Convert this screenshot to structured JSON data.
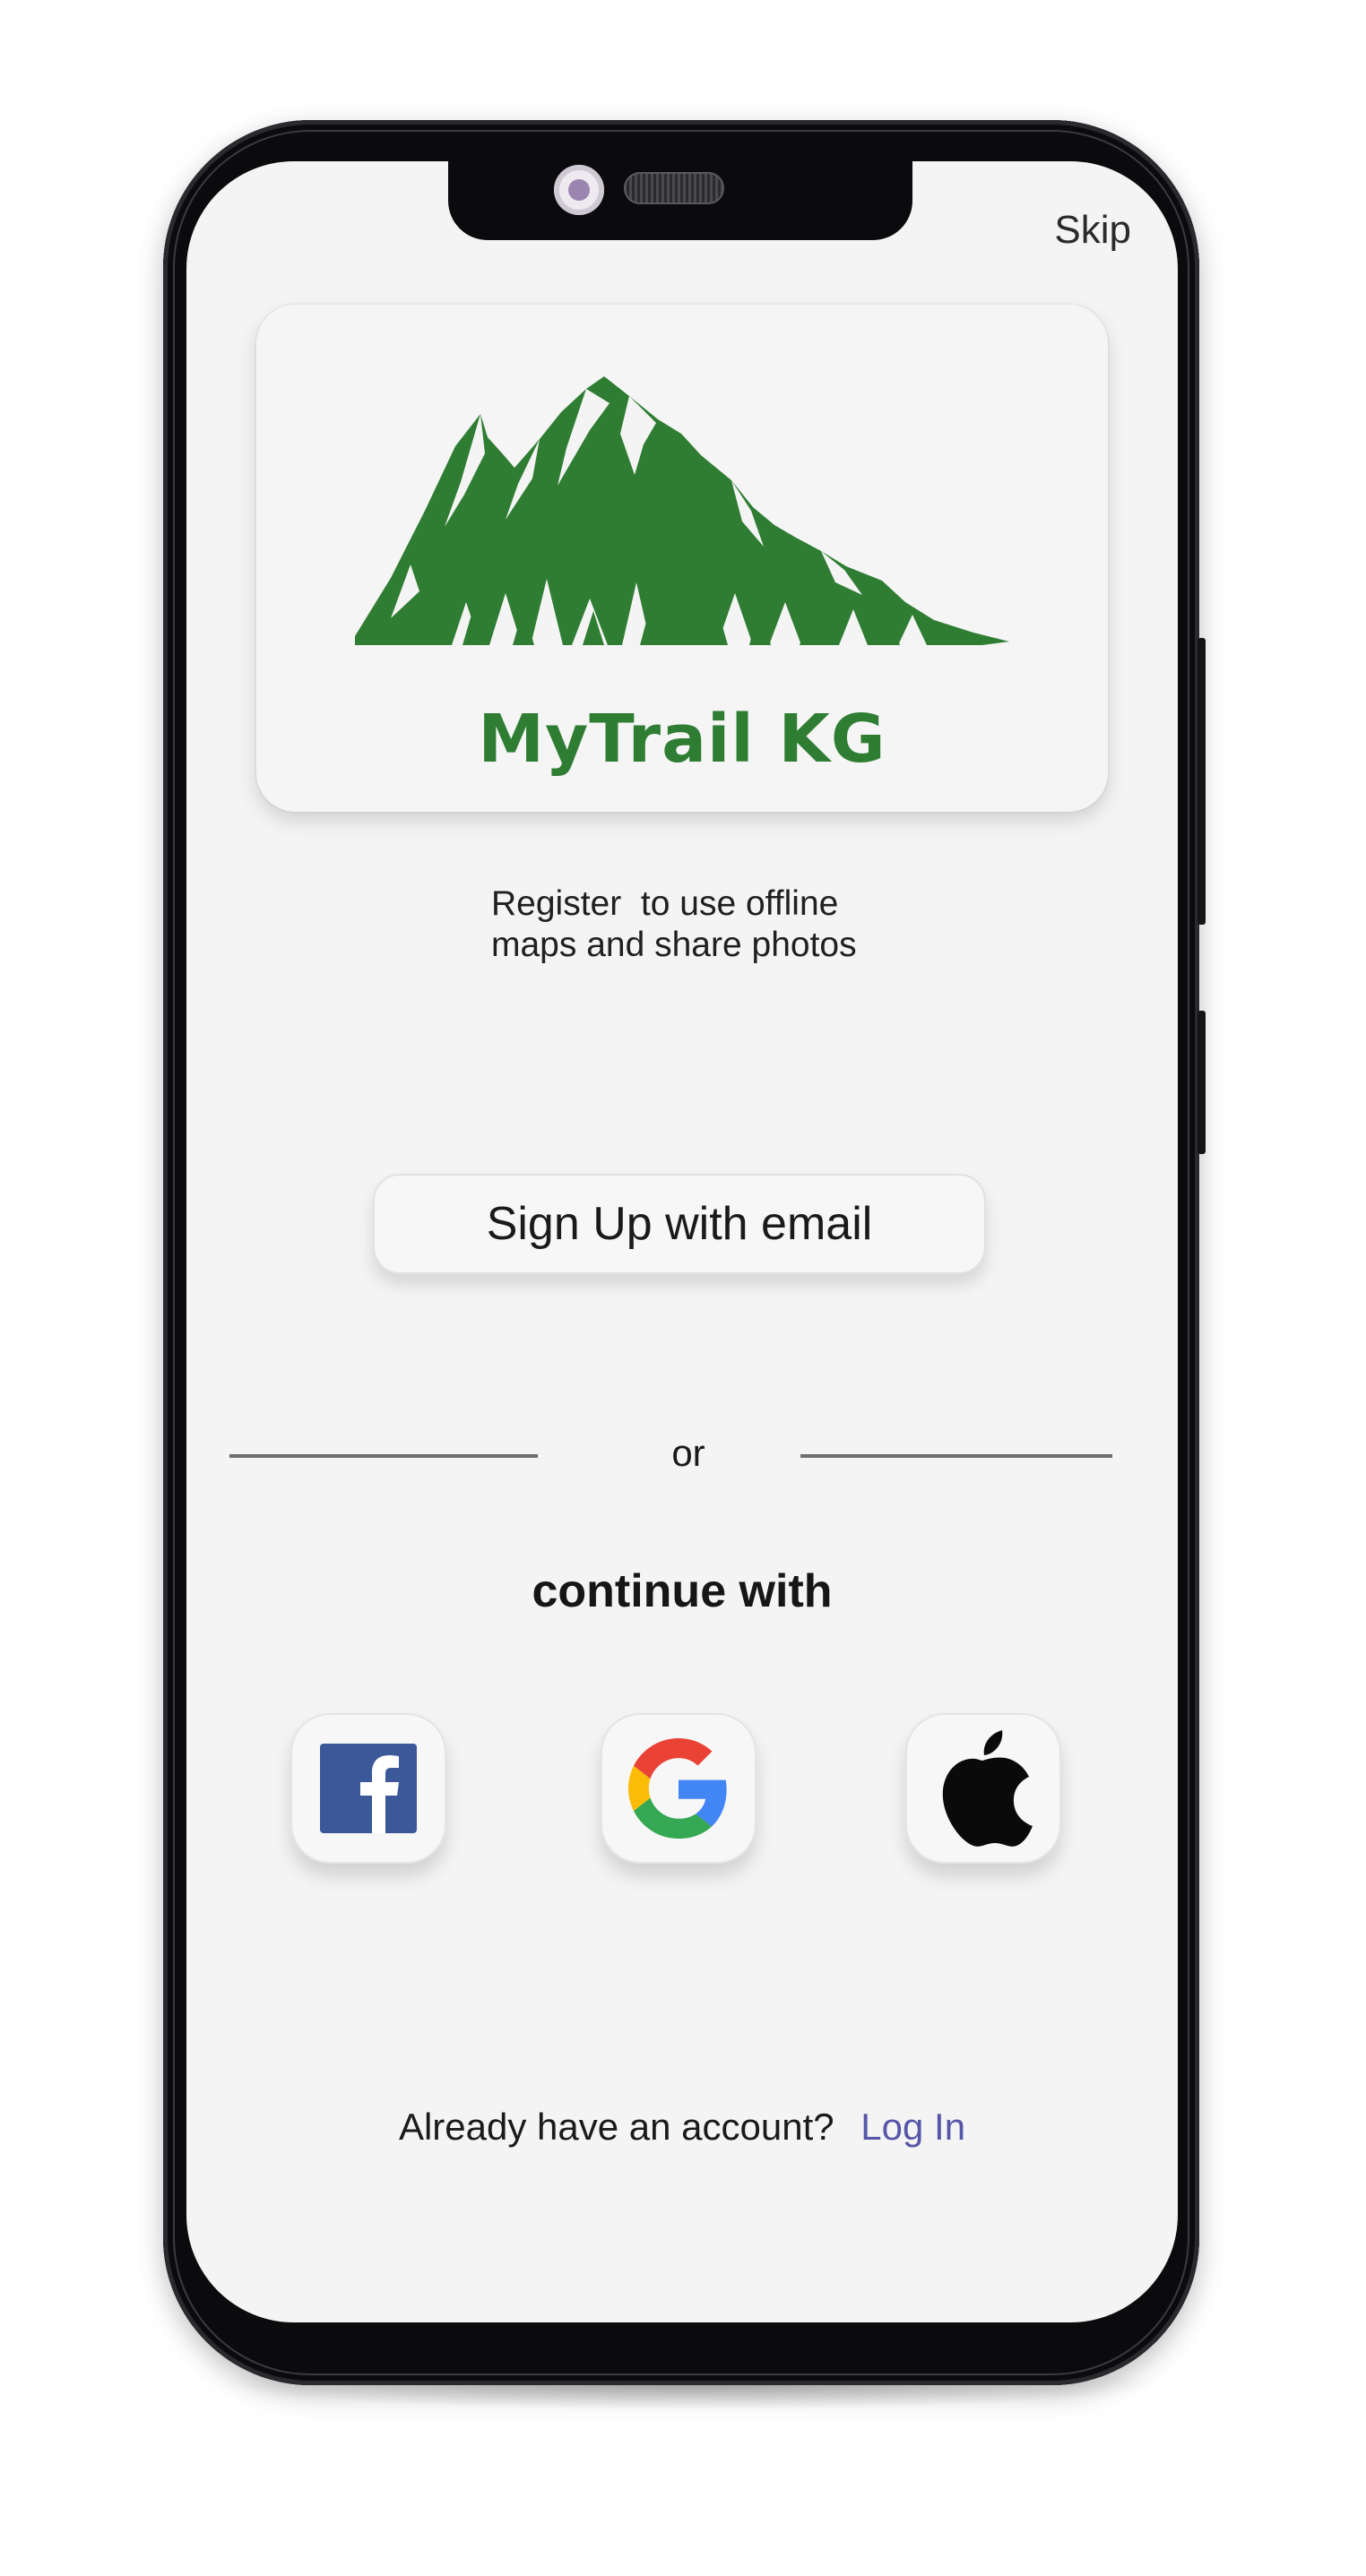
{
  "app": {
    "brand_name": "MyTrail KG",
    "skip_label": "Skip",
    "tagline_line1": "Register  to use offline",
    "tagline_line2": "maps and share photos"
  },
  "actions": {
    "signup_email_label": "Sign Up with email",
    "or_label": "or",
    "continue_label": "continue with"
  },
  "social": [
    {
      "provider": "facebook",
      "icon": "facebook-icon"
    },
    {
      "provider": "google",
      "icon": "google-icon"
    },
    {
      "provider": "apple",
      "icon": "apple-icon"
    }
  ],
  "footer": {
    "prompt": "Already have an account?",
    "login_label": "Log In"
  },
  "colors": {
    "brand_green": "#2f7d32",
    "link": "#5657a8",
    "screen_bg": "#f4f4f4",
    "facebook_blue": "#3b5998"
  }
}
